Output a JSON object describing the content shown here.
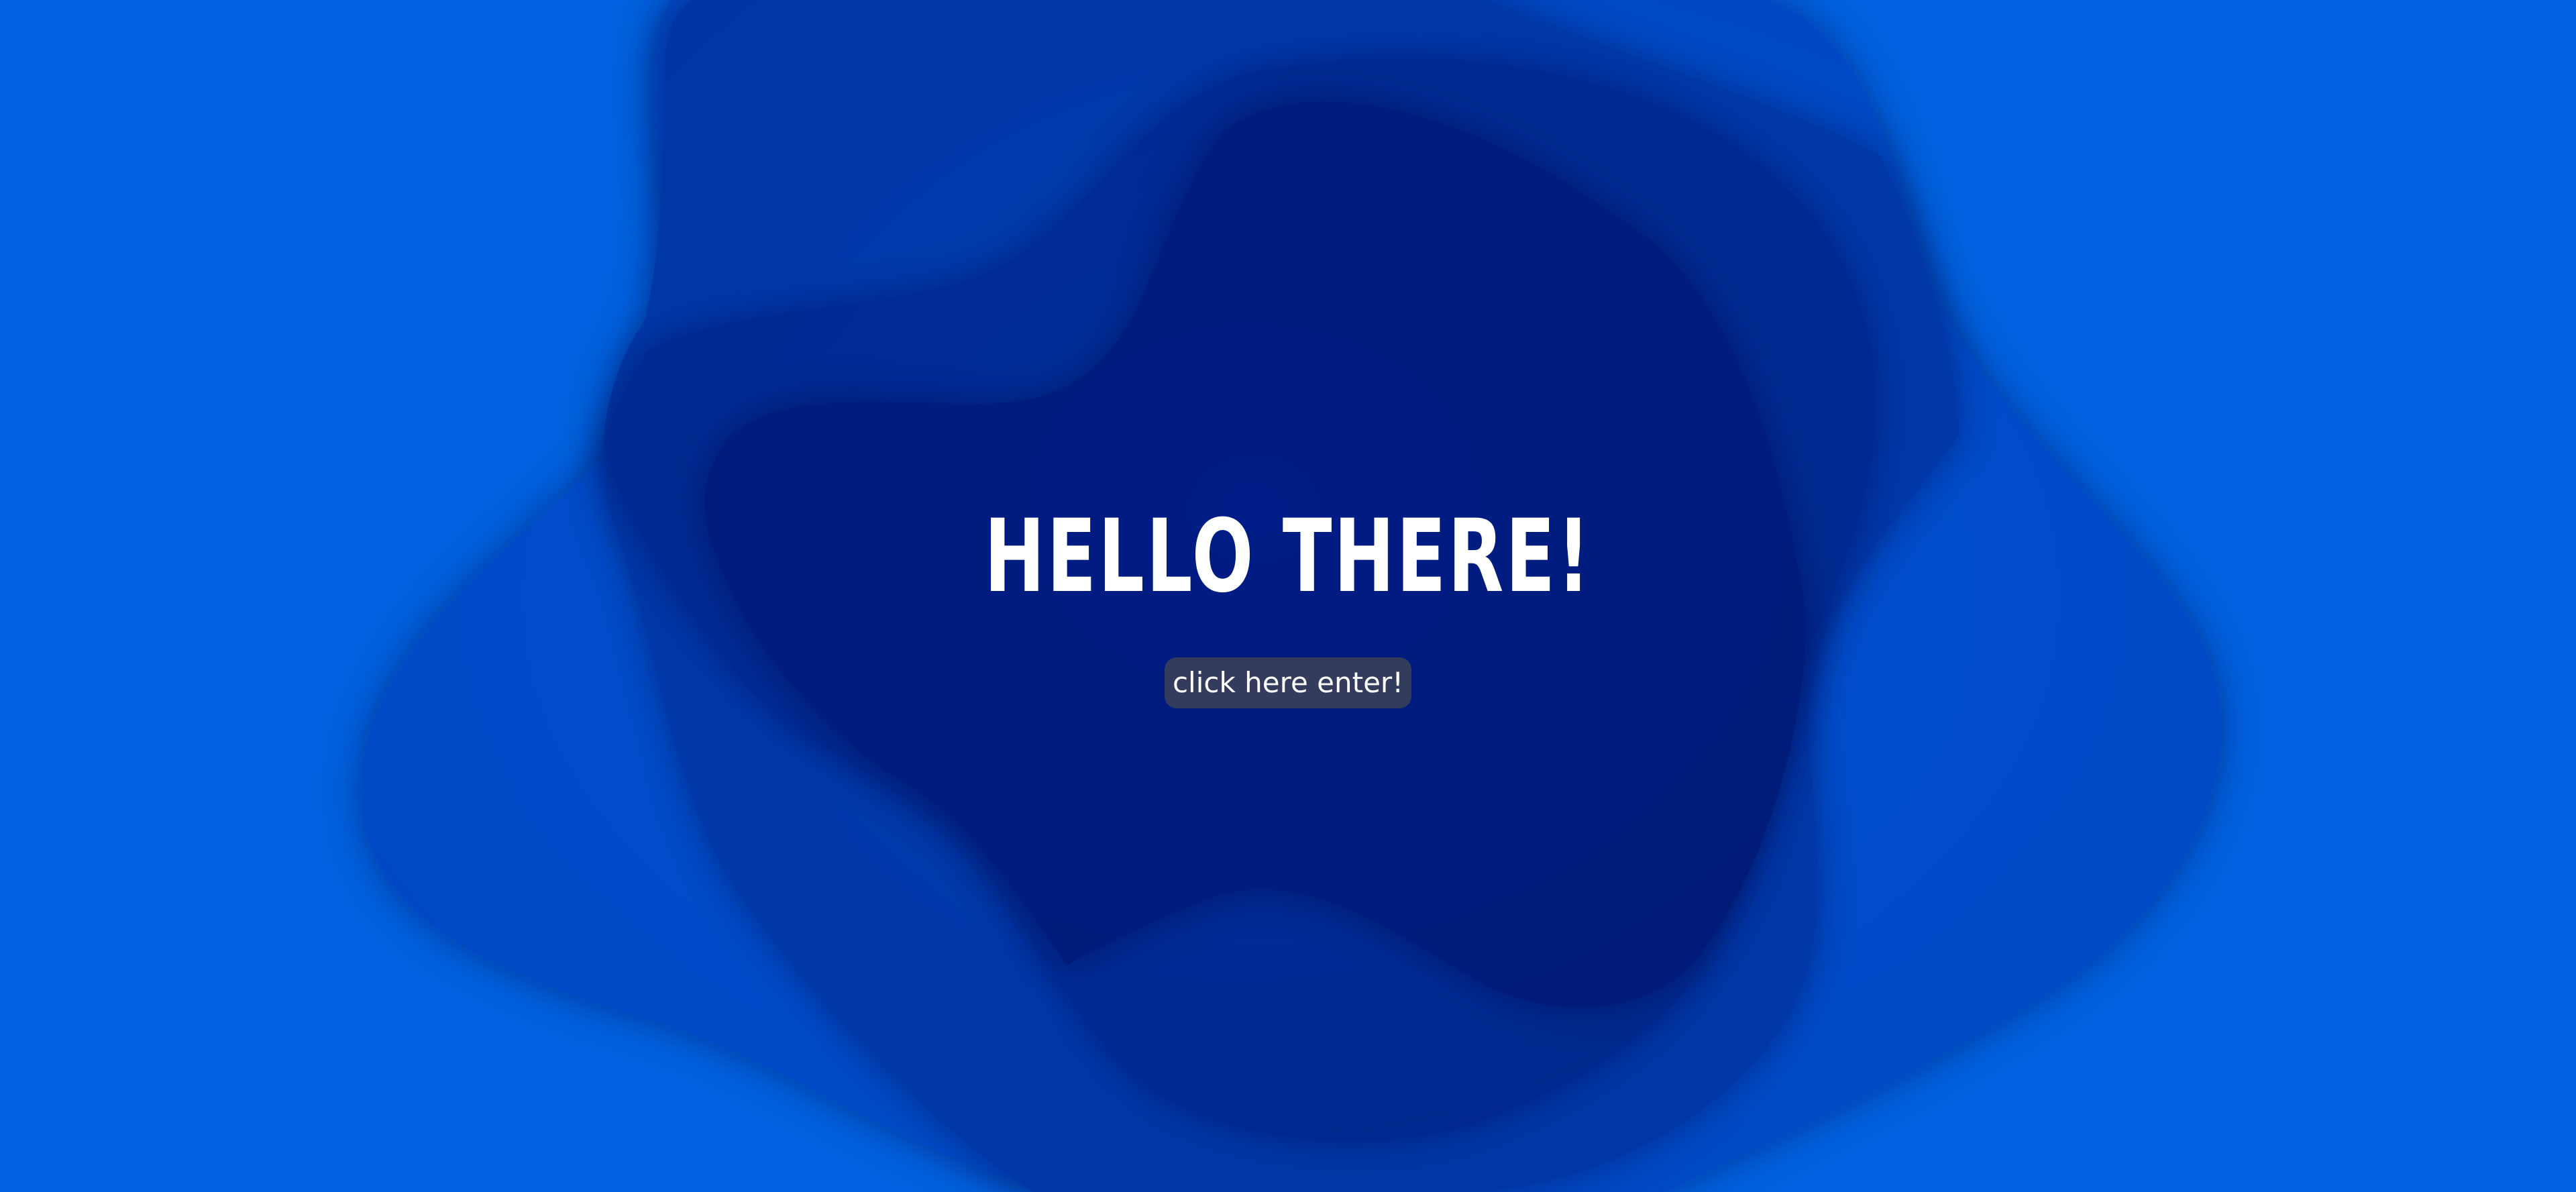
{
  "hero": {
    "title": "HELLO THERE!",
    "button_label": "click here enter!"
  },
  "colors": {
    "background": "#0062e0",
    "layer_1": "#0351cf",
    "layer_2": "#0240b7",
    "layer_3": "#012f9c",
    "layer_4": "#001e82",
    "core": "#001a7d",
    "button": "#343c5e",
    "text": "#ffffff"
  }
}
